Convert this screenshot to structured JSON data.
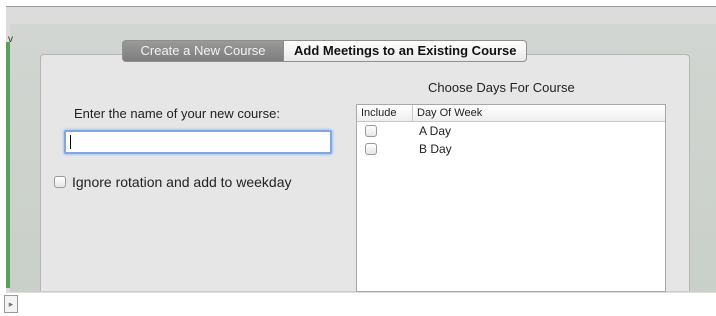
{
  "tabs": {
    "create": "Create a New Course",
    "add": "Add Meetings to an Existing Course"
  },
  "form": {
    "name_label": "Enter the name of your new course:",
    "name_value": "",
    "ignore_label": "Ignore rotation and add to weekday"
  },
  "days": {
    "title": "Choose Days For Course",
    "columns": {
      "include": "Include",
      "day": "Day Of Week"
    },
    "rows": [
      {
        "day": "A Day",
        "checked": false
      },
      {
        "day": "B Day",
        "checked": false
      }
    ]
  },
  "icons": {
    "menu": "v",
    "bottom": "document-icon"
  },
  "colors": {
    "active_tab": "#8a8a8a",
    "focus_ring": "#7fa8e0",
    "green_strip": "#5aa05a"
  }
}
